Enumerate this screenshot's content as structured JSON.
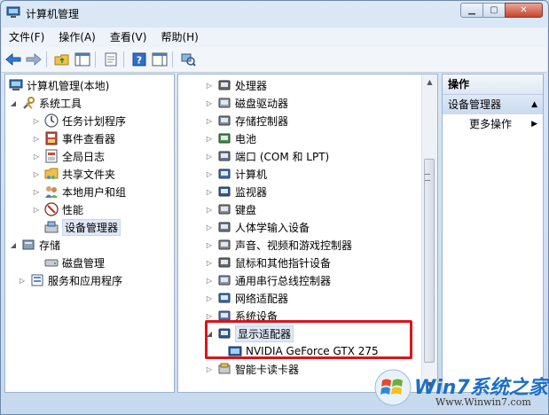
{
  "window": {
    "title": "计算机管理"
  },
  "menubar": {
    "items": [
      "文件(F)",
      "操作(A)",
      "查看(V)",
      "帮助(H)"
    ]
  },
  "toolbar": {
    "icons": [
      "back-arrow-icon",
      "forward-arrow-icon",
      "up-folder-icon",
      "console-tree-icon",
      "properties-icon",
      "help-icon",
      "show-hide-icon",
      "scan-hardware-icon"
    ]
  },
  "left_tree": {
    "root": "计算机管理(本地)",
    "system_tools": "系统工具",
    "items": [
      "任务计划程序",
      "事件查看器",
      "全局日志",
      "共享文件夹",
      "本地用户和组",
      "性能",
      "设备管理器"
    ],
    "storage": "存储",
    "disk_mgmt": "磁盘管理",
    "services": "服务和应用程序"
  },
  "device_tree": {
    "items": [
      "处理器",
      "磁盘驱动器",
      "存储控制器",
      "电池",
      "端口 (COM 和 LPT)",
      "计算机",
      "监视器",
      "键盘",
      "人体学输入设备",
      "声音、视频和游戏控制器",
      "鼠标和其他指针设备",
      "通用串行总线控制器",
      "网络适配器",
      "系统设备",
      "显示适配器"
    ],
    "display_child": "NVIDIA GeForce GTX 275",
    "after": "智能卡读卡器"
  },
  "actions": {
    "header": "操作",
    "primary": "设备管理器",
    "more": "更多操作"
  },
  "watermark": {
    "brand": "Win7系统之家",
    "url": "Www.Winwin7.com"
  },
  "colors": {
    "highlight": "#d9141c",
    "selection": "#dfe8f5"
  }
}
